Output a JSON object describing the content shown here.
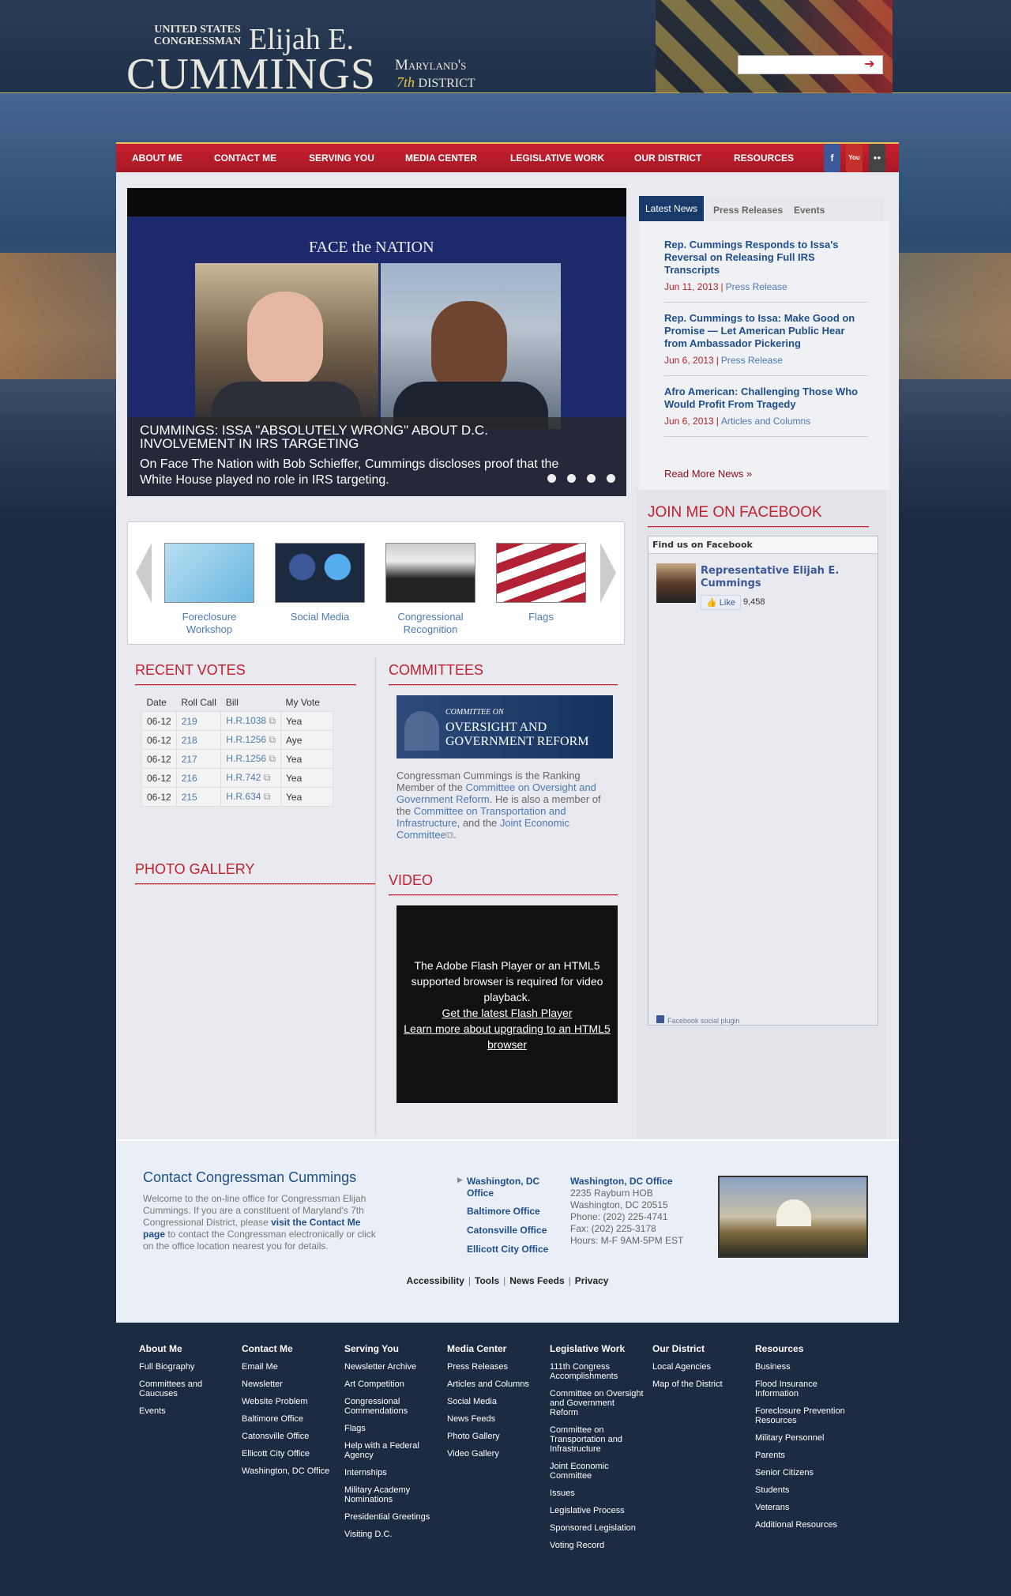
{
  "header": {
    "us_congressman": "United States Congressman",
    "first_name": "Elijah E.",
    "last_name": "Cummings",
    "district_line1": "Maryland's",
    "district_ordinal": "7th",
    "district_line2": "District",
    "search_placeholder": ""
  },
  "nav": {
    "items": [
      "ABOUT ME",
      "CONTACT ME",
      "SERVING YOU",
      "MEDIA CENTER",
      "LEGISLATIVE WORK",
      "OUR DISTRICT",
      "RESOURCES"
    ],
    "social": [
      "f",
      "You",
      "●●"
    ]
  },
  "slider": {
    "network": "FACE the NATION",
    "title": "CUMMINGS: ISSA \"ABSOLUTELY WRONG\" ABOUT D.C. INVOLVEMENT IN IRS TARGETING",
    "description": "On Face The Nation with Bob Schieffer, Cummings discloses proof that the White House played no role in IRS targeting.",
    "slide_count": 4
  },
  "news": {
    "tabs": [
      "Latest News",
      "Press Releases",
      "Events"
    ],
    "items": [
      {
        "title": "Rep. Cummings Responds to Issa's Reversal on Releasing Full IRS Transcripts",
        "date": "Jun 11, 2013",
        "category": "Press Release"
      },
      {
        "title": "Rep. Cummings to Issa: Make Good on Promise — Let American Public Hear from Ambassador Pickering",
        "date": "Jun 6, 2013",
        "category": "Press Release"
      },
      {
        "title": "Afro American: Challenging Those Who Would Profit From Tragedy",
        "date": "Jun 6, 2013",
        "category": "Articles and Columns"
      }
    ],
    "more": "Read More News »"
  },
  "carousel": {
    "items": [
      "Foreclosure Workshop",
      "Social Media",
      "Congressional Recognition",
      "Flags"
    ]
  },
  "facebook": {
    "heading": "JOIN ME ON FACEBOOK",
    "box_title": "Find us on Facebook",
    "page_name": "Representative Elijah E. Cummings",
    "like": "Like",
    "count": "9,458",
    "plugin": "Facebook social plugin"
  },
  "votes": {
    "heading": "RECENT VOTES",
    "headers": [
      "Date",
      "Roll Call",
      "Bill",
      "My Vote"
    ],
    "rows": [
      [
        "06-12",
        "219",
        "H.R.1038",
        "Yea"
      ],
      [
        "06-12",
        "218",
        "H.R.1256",
        "Aye"
      ],
      [
        "06-12",
        "217",
        "H.R.1256",
        "Yea"
      ],
      [
        "06-12",
        "216",
        "H.R.742",
        "Yea"
      ],
      [
        "06-12",
        "215",
        "H.R.634",
        "Yea"
      ]
    ]
  },
  "committees": {
    "heading": "COMMITTEES",
    "image_small": "COMMITTEE ON",
    "image_big": "OVERSIGHT AND GOVERNMENT REFORM",
    "t1": "Congressman Cummings is the Ranking Member of the ",
    "l1": "Committee on Oversight and Government Reform",
    "t2": ". He is also a member of the ",
    "l2": "Committee on Transportation and Infrastructure",
    "t3": ", and the ",
    "l3": "Joint Economic Committee",
    "t4": "."
  },
  "gallery": {
    "heading": "PHOTO GALLERY"
  },
  "video": {
    "heading": "VIDEO",
    "message": "The Adobe Flash Player or an HTML5 supported browser is required for video playback.",
    "link1": "Get the latest Flash Player",
    "link2": "Learn more about upgrading to an HTML5 browser"
  },
  "contact": {
    "heading": "Contact Congressman Cummings",
    "t1": "Welcome to the on-line office for Congressman Elijah Cummings. If you are a constituent of Maryland's 7th Congressional District, please ",
    "link": "visit the Contact Me page",
    "t2": " to contact the Congressman electronically or click on the office location nearest you for details.",
    "offices": [
      "Washington, DC Office",
      "Baltimore Office",
      "Catonsville Office",
      "Ellicott City Office"
    ],
    "detail": {
      "title": "Washington, DC Office",
      "lines": [
        "2235 Rayburn HOB",
        "Washington, DC 20515",
        "Phone: (202) 225-4741",
        "Fax: (202) 225-3178",
        "Hours: M-F 9AM-5PM EST"
      ]
    }
  },
  "footer_links": [
    "Accessibility",
    "Tools",
    "News Feeds",
    "Privacy"
  ],
  "sitemap": [
    {
      "h": "About Me",
      "items": [
        "Full Biography",
        "Committees and Caucuses",
        "Events"
      ]
    },
    {
      "h": "Contact Me",
      "items": [
        "Email Me",
        "Newsletter",
        "Website Problem",
        "Baltimore Office",
        "Catonsville Office",
        "Ellicott City Office",
        "Washington, DC Office"
      ]
    },
    {
      "h": "Serving You",
      "items": [
        "Newsletter Archive",
        "Art Competition",
        "Congressional Commendations",
        "Flags",
        "Help with a Federal Agency",
        "Internships",
        "Military Academy Nominations",
        "Presidential Greetings",
        "Visiting D.C."
      ]
    },
    {
      "h": "Media Center",
      "items": [
        "Press Releases",
        "Articles and Columns",
        "Social Media",
        "News Feeds",
        "Photo Gallery",
        "Video Gallery"
      ]
    },
    {
      "h": "Legislative Work",
      "items": [
        "111th Congress Accomplishments",
        "Committee on Oversight and Government Reform",
        "Committee on Transportation and Infrastructure",
        "Joint Economic Committee",
        "Issues",
        "Legislative Process",
        "Sponsored Legislation",
        "Voting Record"
      ]
    },
    {
      "h": "Our District",
      "items": [
        "Local Agencies",
        "Map of the District"
      ]
    },
    {
      "h": "Resources",
      "items": [
        "Business",
        "Flood Insurance Information",
        "Foreclosure Prevention Resources",
        "Military Personnel",
        "Parents",
        "Senior Citizens",
        "Students",
        "Veterans",
        "Additional Resources"
      ]
    }
  ]
}
